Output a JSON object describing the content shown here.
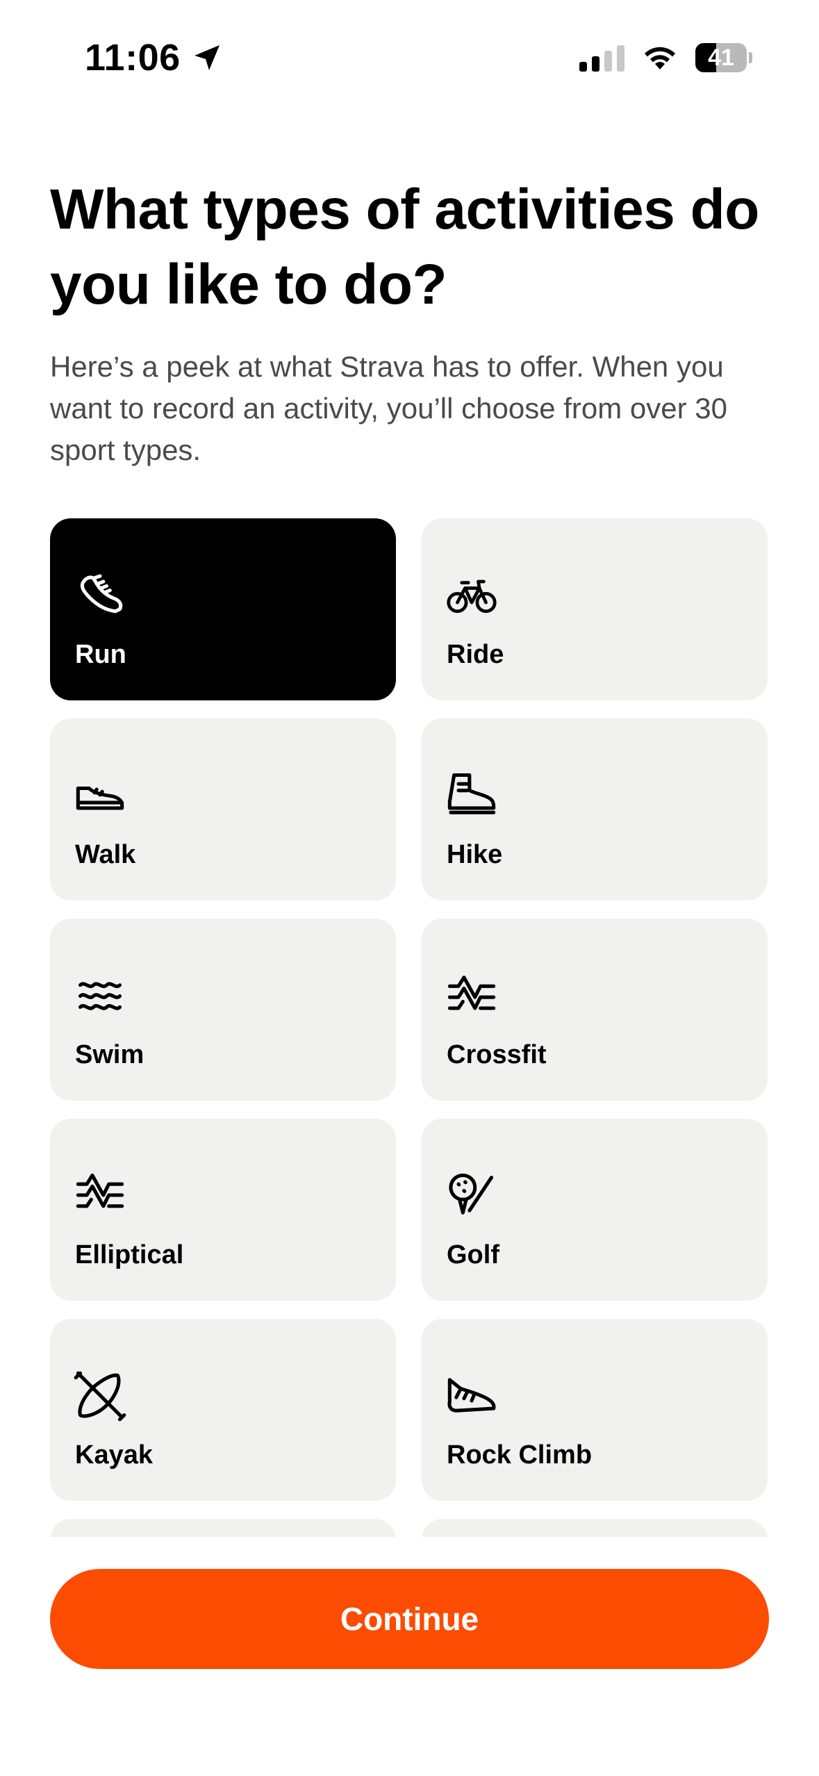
{
  "status_bar": {
    "time": "11:06",
    "battery_level": "41",
    "battery_percent": 41,
    "signal_bars_active": 2,
    "signal_bars_total": 4
  },
  "onboarding": {
    "title": "What types of activities do you like to do?",
    "subtitle": "Here’s a peek at what Strava has to offer. When you want to record an activity, you’ll choose from over 30 sport types."
  },
  "activities": [
    {
      "label": "Run",
      "icon": "running-shoe-icon",
      "selected": true
    },
    {
      "label": "Ride",
      "icon": "bicycle-icon",
      "selected": false
    },
    {
      "label": "Walk",
      "icon": "walking-shoe-icon",
      "selected": false
    },
    {
      "label": "Hike",
      "icon": "hiking-boot-icon",
      "selected": false
    },
    {
      "label": "Swim",
      "icon": "waves-icon",
      "selected": false
    },
    {
      "label": "Crossfit",
      "icon": "crossfit-icon",
      "selected": false
    },
    {
      "label": "Elliptical",
      "icon": "elliptical-icon",
      "selected": false
    },
    {
      "label": "Golf",
      "icon": "golf-icon",
      "selected": false
    },
    {
      "label": "Kayak",
      "icon": "kayak-icon",
      "selected": false
    },
    {
      "label": "Rock Climb",
      "icon": "climbing-shoe-icon",
      "selected": false
    }
  ],
  "actions": {
    "continue_label": "Continue"
  },
  "colors": {
    "accent": "#fc4c02",
    "tile_background": "#f1f1f0",
    "tile_selected": "#000000"
  }
}
